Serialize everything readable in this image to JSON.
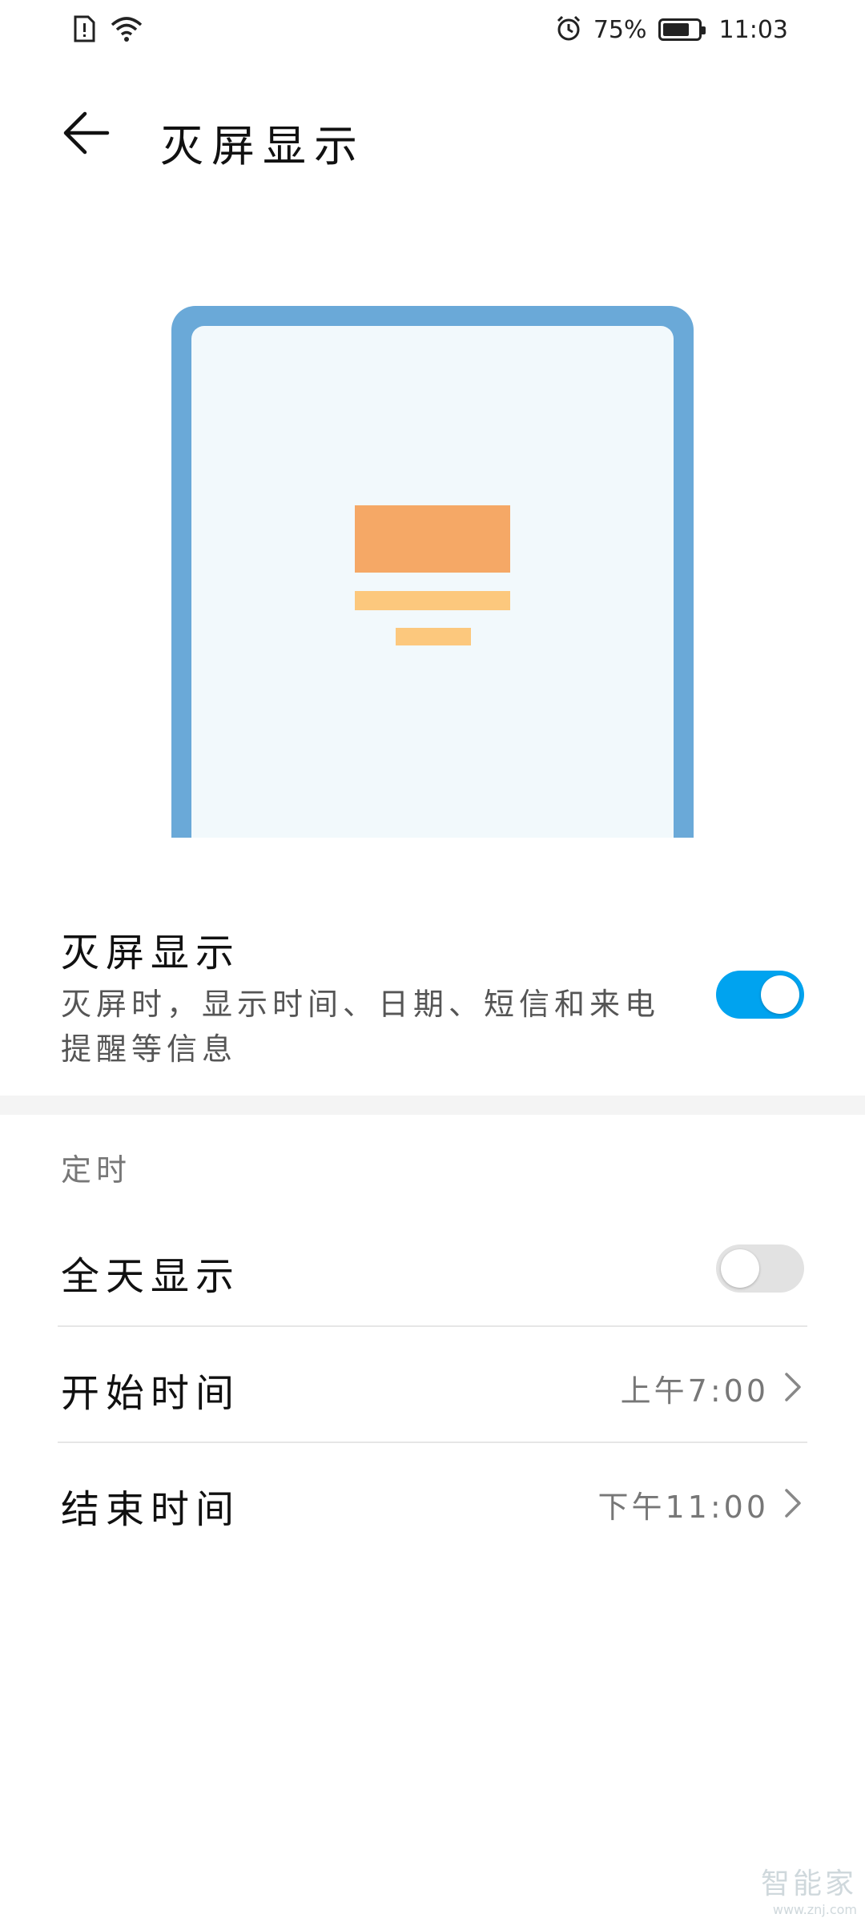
{
  "status_bar": {
    "battery_percent": "75%",
    "battery_level": 0.75,
    "time": "11:03",
    "icons": [
      "sim-alert-icon",
      "wifi-icon",
      "alarm-icon",
      "battery-icon"
    ]
  },
  "header": {
    "title": "灭屏显示"
  },
  "aod": {
    "title": "灭屏显示",
    "description": "灭屏时，显示时间、日期、短信和来电提醒等信息",
    "enabled": true
  },
  "schedule": {
    "section_label": "定时",
    "all_day": {
      "label": "全天显示",
      "enabled": false
    },
    "start": {
      "label": "开始时间",
      "value": "上午7:00"
    },
    "end": {
      "label": "结束时间",
      "value": "下午11:00"
    }
  },
  "watermark": {
    "text": "智能家",
    "url": "www.znj.com"
  },
  "colors": {
    "accent": "#00a3ef",
    "frame": "#6aa9d8",
    "orange": "#f5a866",
    "light_orange": "#fcc87d"
  }
}
